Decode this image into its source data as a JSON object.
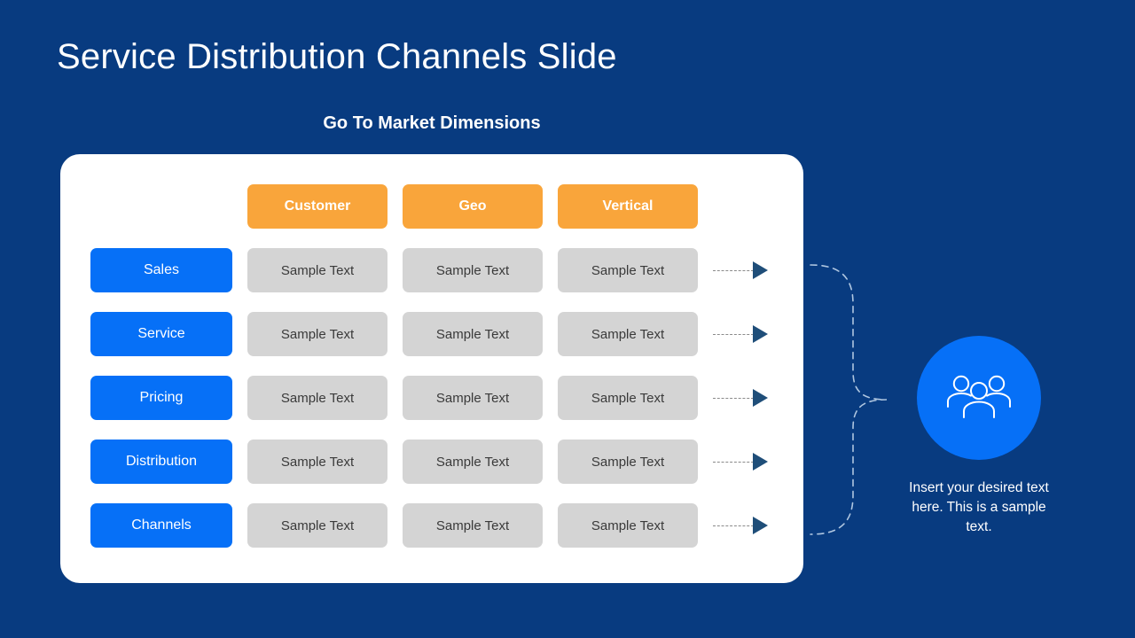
{
  "slide": {
    "title": "Service Distribution Channels Slide",
    "subtitle": "Go To Market Dimensions",
    "background_color": "#083B80"
  },
  "theme": {
    "navy": "#083B80",
    "blue": "#0670F7",
    "orange": "#F9A53B",
    "gray": "#D4D4D4",
    "arrow_navy": "#1F4E79",
    "card_white": "#FFFFFF"
  },
  "matrix": {
    "column_headers": [
      "Customer",
      "Geo",
      "Vertical"
    ],
    "rows": [
      {
        "label": "Sales",
        "cells": [
          "Sample Text",
          "Sample Text",
          "Sample Text"
        ]
      },
      {
        "label": "Service",
        "cells": [
          "Sample Text",
          "Sample Text",
          "Sample Text"
        ]
      },
      {
        "label": "Pricing",
        "cells": [
          "Sample Text",
          "Sample Text",
          "Sample Text"
        ]
      },
      {
        "label": "Distribution",
        "cells": [
          "Sample Text",
          "Sample Text",
          "Sample Text"
        ]
      },
      {
        "label": "Channels",
        "cells": [
          "Sample Text",
          "Sample Text",
          "Sample Text"
        ]
      }
    ]
  },
  "side_panel": {
    "icon": "people-group-icon",
    "caption": "Insert your desired text here. This is a sample text."
  }
}
